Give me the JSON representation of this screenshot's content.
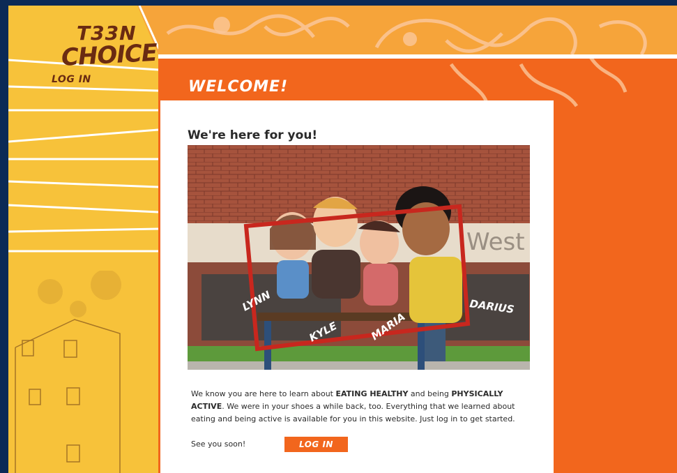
{
  "brand": {
    "logo_line1": "T33N",
    "logo_line2": "CHOICE"
  },
  "sidebar": {
    "login_label": "LOG IN"
  },
  "banner": {
    "welcome": "WELCOME!"
  },
  "content": {
    "heading": "We're here for you!",
    "hero": {
      "sign_text": "West",
      "names": [
        "LYNN",
        "KYLE",
        "MARIA",
        "DARIUS"
      ]
    },
    "intro_1": "We know you are here to learn about ",
    "intro_em1": "EATING HEALTHY",
    "intro_2": " and being ",
    "intro_em2": "PHYSICALLY ACTIVE",
    "intro_3": ". We were in your shoes a while back, too. Everything that we learned about eating and being active is available for you in this website. Just log in to get started.",
    "signoff": "See you soon!",
    "login_button": "LOG IN"
  },
  "colors": {
    "orange": "#f2661d",
    "yellow": "#f7c23a",
    "peach": "#f6a43a",
    "navy": "#0c2a56"
  }
}
